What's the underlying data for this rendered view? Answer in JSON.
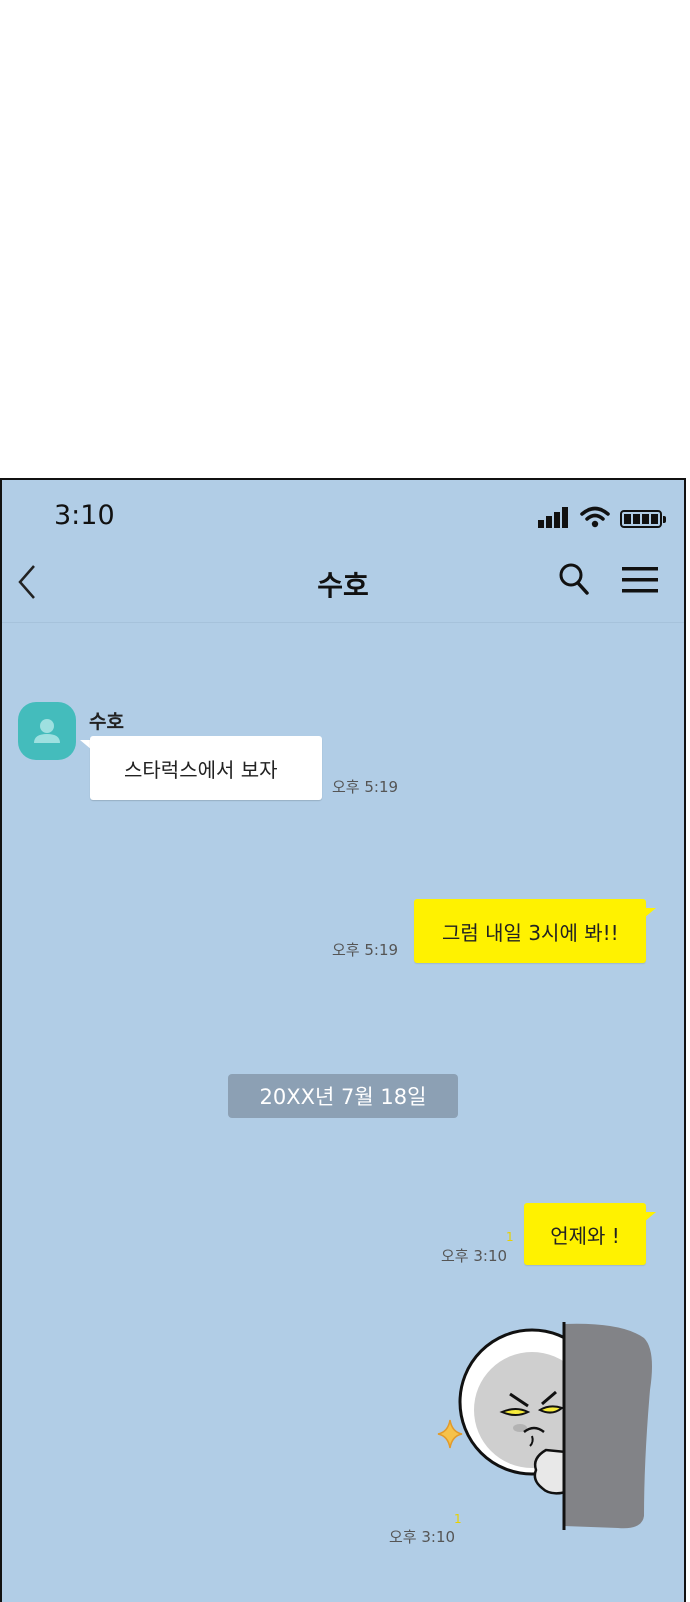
{
  "status_bar": {
    "time": "3:10"
  },
  "header": {
    "title": "수호"
  },
  "messages": [
    {
      "sender": "수호",
      "text": "스타럭스에서 보자",
      "time": "오후 5:19"
    },
    {
      "text": "그럼 내일 3시에 봐!!",
      "time": "오후 5:19"
    },
    {
      "text": "언제와 !",
      "time": "오후 3:10",
      "unread": "1"
    },
    {
      "sticker": "peeking-face-sticker",
      "time": "오후 3:10",
      "unread": "1"
    }
  ],
  "date_divider": "20XX년 7월 18일",
  "colors": {
    "background": "#b1cde6",
    "my_bubble": "#fff200",
    "their_bubble": "#ffffff",
    "avatar": "#44bcbc",
    "date_pill": "#8ca0b4"
  }
}
